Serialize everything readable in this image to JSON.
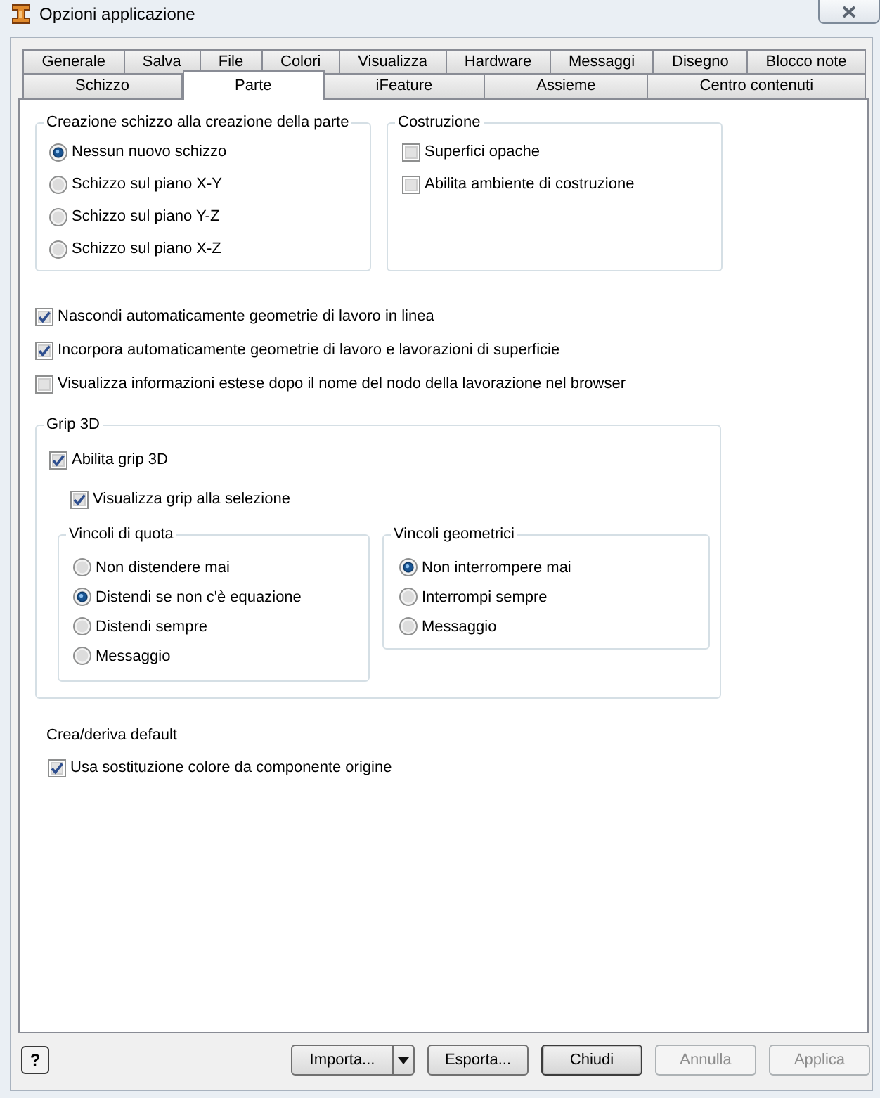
{
  "window": {
    "title": "Opzioni applicazione"
  },
  "tab_rows": [
    {
      "tabs": [
        {
          "label": "Generale",
          "selected": false
        },
        {
          "label": "Salva",
          "selected": false
        },
        {
          "label": "File",
          "selected": false
        },
        {
          "label": "Colori",
          "selected": false
        },
        {
          "label": "Visualizza",
          "selected": false
        },
        {
          "label": "Hardware",
          "selected": false
        },
        {
          "label": "Messaggi",
          "selected": false
        },
        {
          "label": "Disegno",
          "selected": false
        },
        {
          "label": "Blocco note",
          "selected": false
        }
      ]
    },
    {
      "tabs": [
        {
          "label": "Schizzo",
          "selected": false
        },
        {
          "label": "Parte",
          "selected": true
        },
        {
          "label": "iFeature",
          "selected": false
        },
        {
          "label": "Assieme",
          "selected": false
        },
        {
          "label": "Centro contenuti",
          "selected": false
        }
      ]
    }
  ],
  "sketch_creation": {
    "title": "Creazione schizzo alla creazione della parte",
    "options": [
      {
        "label": "Nessun nuovo schizzo",
        "selected": true
      },
      {
        "label": "Schizzo sul piano X-Y",
        "selected": false
      },
      {
        "label": "Schizzo sul piano Y-Z",
        "selected": false
      },
      {
        "label": "Schizzo sul piano X-Z",
        "selected": false
      }
    ]
  },
  "construction": {
    "title": "Costruzione",
    "options": [
      {
        "label": "Superfici opache",
        "checked": false
      },
      {
        "label": "Abilita ambiente di costruzione",
        "checked": false
      }
    ]
  },
  "options": [
    {
      "label": "Nascondi automaticamente geometrie di lavoro in linea",
      "checked": true
    },
    {
      "label": "Incorpora automaticamente geometrie di lavoro e lavorazioni di superficie",
      "checked": true
    },
    {
      "label": "Visualizza informazioni estese dopo il nome del nodo della lavorazione nel browser",
      "checked": false
    }
  ],
  "grip_3d": {
    "title": "Grip 3D",
    "enable": {
      "label": "Abilita grip 3D",
      "checked": true
    },
    "show_on_selection": {
      "label": "Visualizza grip alla selezione",
      "checked": true
    },
    "dimension_constraints": {
      "title": "Vincoli di quota",
      "options": [
        {
          "label": "Non distendere mai",
          "selected": false
        },
        {
          "label": "Distendi se non c'è equazione",
          "selected": true
        },
        {
          "label": "Distendi sempre",
          "selected": false
        },
        {
          "label": "Messaggio",
          "selected": false
        }
      ]
    },
    "geometric_constraints": {
      "title": "Vincoli geometrici",
      "options": [
        {
          "label": "Non interrompere mai",
          "selected": true
        },
        {
          "label": "Interrompi sempre",
          "selected": false
        },
        {
          "label": "Messaggio",
          "selected": false
        }
      ]
    }
  },
  "derive_defaults": {
    "title": "Crea/deriva default",
    "options": [
      {
        "label": "Usa sostituzione colore da componente origine",
        "checked": true
      }
    ]
  },
  "help_button": {
    "label": "?"
  },
  "buttons": [
    {
      "label": "Importa...",
      "kind": "split",
      "disabled": false,
      "default": false
    },
    {
      "label": "Esporta...",
      "kind": "push",
      "disabled": false,
      "default": false
    },
    {
      "label": "Chiudi",
      "kind": "push",
      "disabled": false,
      "default": true
    },
    {
      "label": "Annulla",
      "kind": "push",
      "disabled": true,
      "default": false
    },
    {
      "label": "Applica",
      "kind": "push",
      "disabled": true,
      "default": false
    }
  ]
}
